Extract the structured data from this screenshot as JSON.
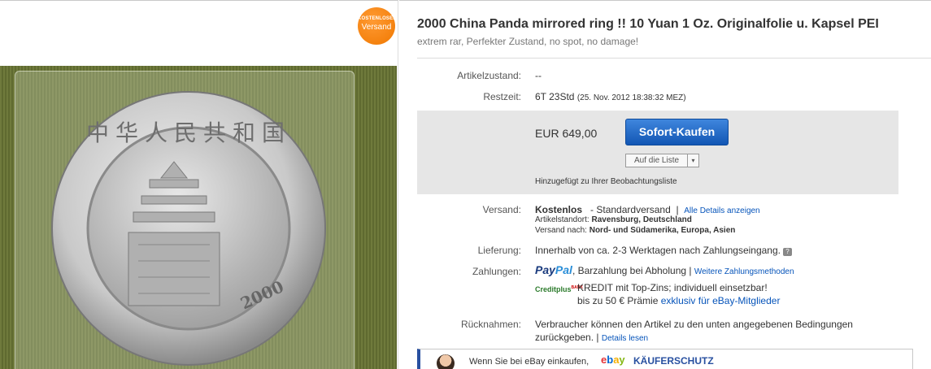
{
  "badge": {
    "line1": "KOSTENLOSER",
    "line2": "Versand"
  },
  "photo": {
    "coin_text": "中华人民共和国",
    "coin_year": "2000"
  },
  "listing": {
    "title": "2000 China Panda mirrored ring !! 10 Yuan 1 Oz. Originalfolie u. Kapsel PEI",
    "subtitle": "extrem rar, Perfekter Zustand, no spot, no damage!"
  },
  "condition": {
    "label": "Artikelzustand:",
    "value": "--"
  },
  "time_left": {
    "label": "Restzeit:",
    "value": "6T 23Std",
    "end": "(25. Nov. 2012 18:38:32 MEZ)"
  },
  "buy": {
    "price": "EUR 649,00",
    "button": "Sofort-Kaufen",
    "watch_label": "Auf die Liste",
    "watch_arrow": "▾",
    "added_note": "Hinzugefügt zu Ihrer Beobachtungsliste"
  },
  "shipping": {
    "label": "Versand:",
    "cost": "Kostenlos",
    "method": "- Standardversand",
    "divider": "|",
    "details_link": "Alle Details anzeigen",
    "location_label": "Artikelstandort:",
    "location": "Ravensburg, Deutschland",
    "ships_to_label": "Versand nach:",
    "ships_to": "Nord- und Südamerika, Europa, Asien"
  },
  "delivery": {
    "label": "Lieferung:",
    "value": "Innerhalb von ca. 2-3 Werktagen nach Zahlungseingang.",
    "icon": "info-icon"
  },
  "payment": {
    "label": "Zahlungen:",
    "paypal_1": "Pay",
    "paypal_2": "Pal",
    "pickup": ", Barzahlung bei Abholung",
    "divider": "|",
    "more_link": "Weitere Zahlungsmethoden",
    "credit_logo": "Creditplus",
    "credit_logo_small": "BANK",
    "credit_line1": "KREDIT mit Top-Zins; individuell einsetzbar!",
    "credit_line2a": "bis zu 50 € Prämie",
    "credit_line2b": "exklusiv für eBay-Mitglieder"
  },
  "returns": {
    "label": "Rücknahmen:",
    "line1": "Verbraucher können den Artikel zu den unten angegebenen Bedingungen",
    "line2": "zurückgeben.",
    "divider": "|",
    "details_link": "Details lesen"
  },
  "footer": {
    "text": "Wenn Sie bei eBay einkaufen,",
    "ebay_e": "e",
    "ebay_b": "b",
    "ebay_a": "a",
    "ebay_y": "y",
    "protection": "KÄUFERSCHUTZ"
  },
  "colors": {
    "accent_blue": "#0654ba",
    "button_blue": "#1256b4",
    "badge_orange": "#f07800",
    "price_box": "#e6e6e6"
  }
}
